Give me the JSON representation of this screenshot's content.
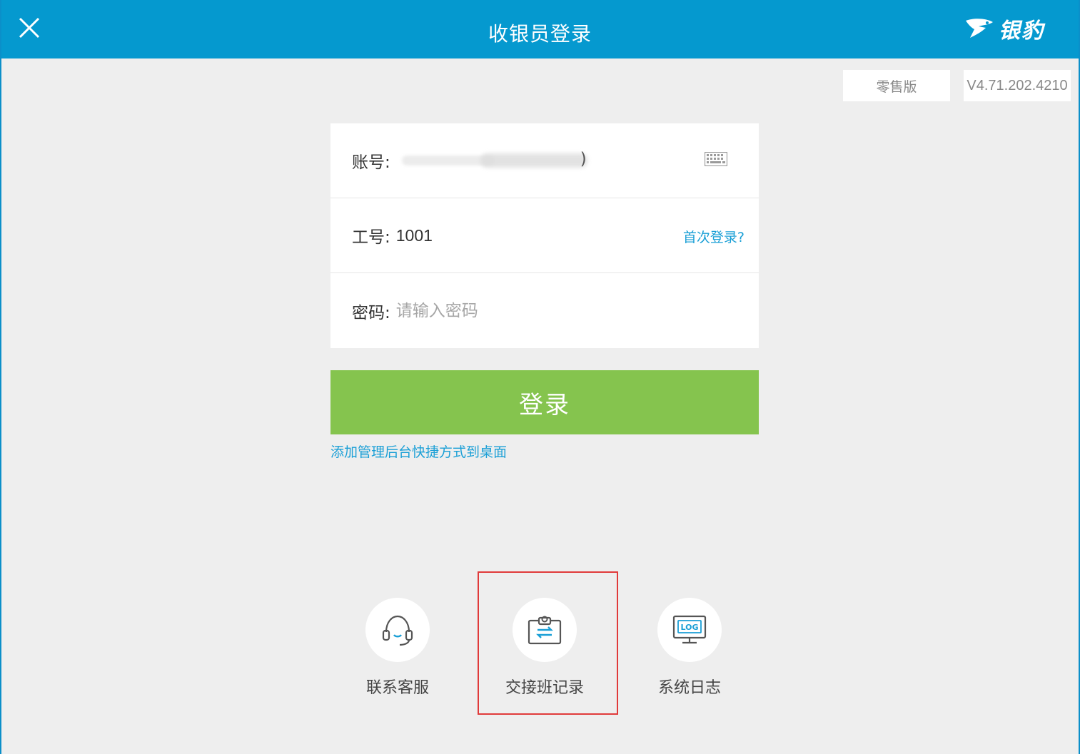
{
  "titlebar": {
    "title": "收银员登录",
    "brand": "银豹",
    "close_icon": "close-icon",
    "brand_icon": "leopard-logo-icon"
  },
  "badges": {
    "edition": "零售版",
    "version": "V4.71.202.4210"
  },
  "form": {
    "account_label": "账号:",
    "account_value_masked": ")",
    "keyboard_icon": "keyboard-icon",
    "employee_label": "工号:",
    "employee_value": "1001",
    "first_login_link": "首次登录?",
    "password_label": "密码:",
    "password_placeholder": "请输入密码"
  },
  "login_button": "登录",
  "shortcut_link": "添加管理后台快捷方式到桌面",
  "tools": [
    {
      "label": "联系客服",
      "icon": "headset-icon"
    },
    {
      "label": "交接班记录",
      "icon": "shift-handover-clipboard-icon"
    },
    {
      "label": "系统日志",
      "icon": "log-monitor-icon"
    }
  ],
  "colors": {
    "titlebar": "#0599cf",
    "login_button": "#85c44e",
    "link": "#1a9fd6",
    "highlight": "#e03a3a"
  }
}
